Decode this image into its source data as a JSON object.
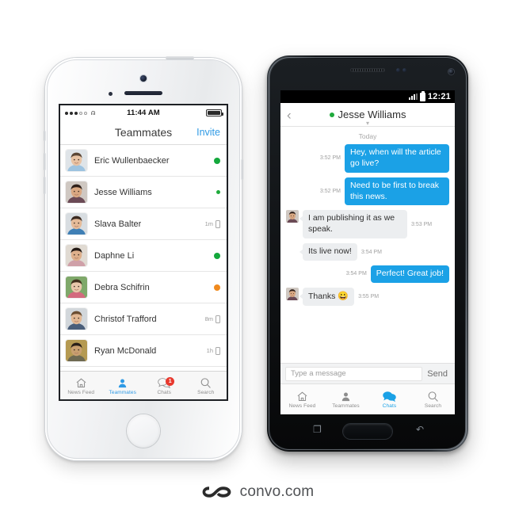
{
  "brand": {
    "name": "convo.com",
    "mark": "infinity-logo-icon"
  },
  "iphone": {
    "status": {
      "carrier_dots": "•••oo",
      "wifi_icon": "wifi-icon",
      "time": "11:44 AM",
      "battery_icon": "battery-full-icon"
    },
    "nav": {
      "title": "Teammates",
      "action_label": "Invite"
    },
    "teammates": [
      {
        "name": "Eric Wullenbaecker",
        "status_color": "#14a83c",
        "dot_size": "big",
        "meta": "",
        "device": ""
      },
      {
        "name": "Jesse Williams",
        "status_color": "#1faa3c",
        "dot_size": "small",
        "meta": "",
        "device": ""
      },
      {
        "name": "Slava Balter",
        "status_color": "",
        "dot_size": "",
        "meta": "1m",
        "device": "mobile-icon"
      },
      {
        "name": "Daphne Li",
        "status_color": "#14a83c",
        "dot_size": "big",
        "meta": "",
        "device": ""
      },
      {
        "name": "Debra Schifrin",
        "status_color": "#f08a1e",
        "dot_size": "big",
        "meta": "",
        "device": ""
      },
      {
        "name": "Christof Trafford",
        "status_color": "",
        "dot_size": "",
        "meta": "8m",
        "device": "mobile-icon"
      },
      {
        "name": "Ryan McDonald",
        "status_color": "",
        "dot_size": "",
        "meta": "1h",
        "device": "mobile-icon"
      }
    ],
    "tabs": [
      {
        "label": "News Feed",
        "icon": "home-icon",
        "active": false,
        "badge": ""
      },
      {
        "label": "Teammates",
        "icon": "person-icon",
        "active": true,
        "badge": ""
      },
      {
        "label": "Chats",
        "icon": "chat-bubbles-icon",
        "active": false,
        "badge": "1"
      },
      {
        "label": "Search",
        "icon": "magnifier-icon",
        "active": false,
        "badge": ""
      }
    ],
    "accent": "#2f9ae5"
  },
  "android": {
    "status": {
      "signal_icon": "signal-bars-icon",
      "battery_icon": "battery-icon",
      "time": "12:21"
    },
    "nav": {
      "back_icon": "chevron-left-icon",
      "presence_color": "#1faa3c",
      "title": "Jesse Williams",
      "expand_icon": "chevron-down-icon"
    },
    "day_separator": "Today",
    "messages": [
      {
        "side": "out",
        "text": "Hey, when will the article go live?",
        "time": "3:52 PM",
        "avatar": false,
        "emoji": ""
      },
      {
        "side": "out",
        "text": "Need to be first to break this news.",
        "time": "3:52 PM",
        "avatar": false,
        "emoji": ""
      },
      {
        "side": "in",
        "text": "I am publishing it as we speak.",
        "time": "3:53 PM",
        "avatar": true,
        "emoji": ""
      },
      {
        "side": "in",
        "text": "Its live now!",
        "time": "3:54 PM",
        "avatar": false,
        "emoji": ""
      },
      {
        "side": "out",
        "text": "Perfect! Great job!",
        "time": "3:54 PM",
        "avatar": false,
        "emoji": ""
      },
      {
        "side": "in",
        "text": "Thanks",
        "time": "3:55 PM",
        "avatar": true,
        "emoji": "😀"
      }
    ],
    "compose": {
      "placeholder": "Type a message",
      "value": "",
      "send_label": "Send"
    },
    "tabs": [
      {
        "label": "News Feed",
        "icon": "home-icon",
        "active": false
      },
      {
        "label": "Teammates",
        "icon": "person-icon",
        "active": false
      },
      {
        "label": "Chats",
        "icon": "chat-bubbles-icon",
        "active": true
      },
      {
        "label": "Search",
        "icon": "magnifier-icon",
        "active": false
      }
    ],
    "softkeys": {
      "recent_icon": "recent-apps-icon",
      "home_icon": "home-key-icon",
      "back_icon": "back-arrow-icon"
    },
    "accent": "#1ba1e6"
  }
}
